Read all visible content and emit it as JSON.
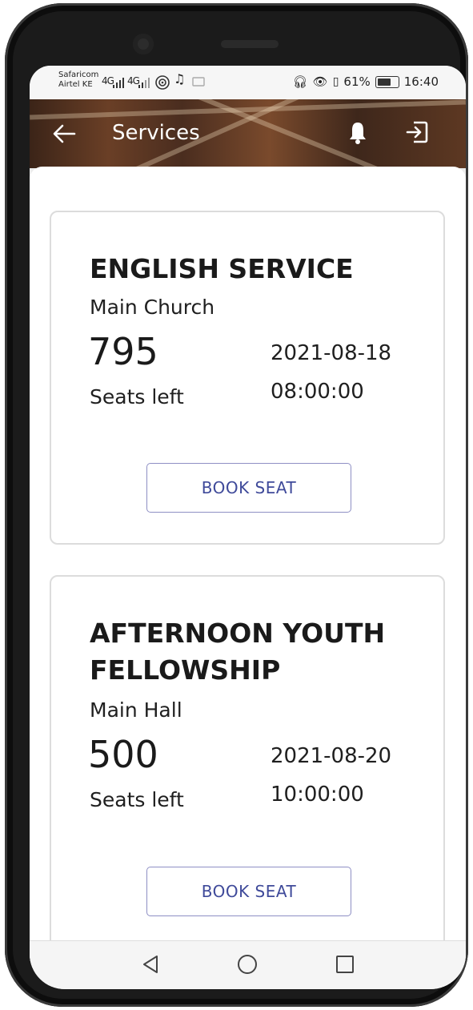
{
  "status_bar": {
    "carrier_1": "Safaricom",
    "carrier_2": "Airtel KE",
    "network_1": "4G",
    "network_2": "4G",
    "battery": "61%",
    "time": "16:40"
  },
  "app_bar": {
    "title": "Services",
    "icons": [
      "back-arrow-icon",
      "bell-icon",
      "exit-icon"
    ]
  },
  "services": [
    {
      "name": "ENGLISH SERVICE",
      "venue": "Main Church",
      "seats": "795",
      "seats_label": "Seats left",
      "date": "2021-08-18",
      "time": "08:00:00",
      "button": "BOOK SEAT"
    },
    {
      "name": "AFTERNOON YOUTH FELLOWSHIP",
      "venue": "Main Hall",
      "seats": "500",
      "seats_label": "Seats left",
      "date": "2021-08-20",
      "time": "10:00:00",
      "button": "BOOK SEAT"
    }
  ],
  "colors": {
    "accent": "#3f4a9a",
    "button_border": "#8e8fc4",
    "card_border": "#dcdcdc"
  }
}
